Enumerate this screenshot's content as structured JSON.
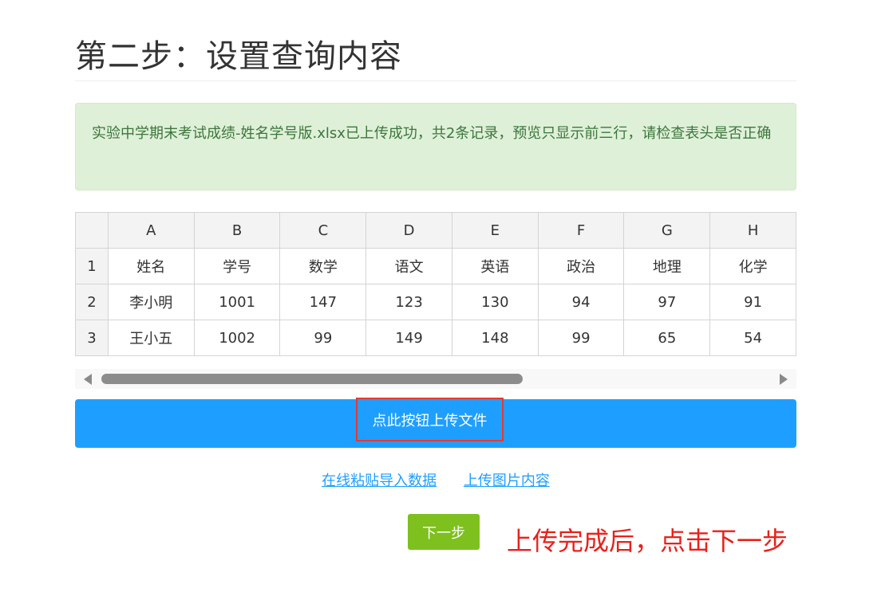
{
  "page": {
    "title": "第二步：设置查询内容"
  },
  "alert": {
    "message": "实验中学期末考试成绩-姓名学号版.xlsx已上传成功，共2条记录，预览只显示前三行，请检查表头是否正确"
  },
  "sheet": {
    "column_letters": [
      "A",
      "B",
      "C",
      "D",
      "E",
      "F",
      "G",
      "H"
    ],
    "rows": [
      {
        "num": "1",
        "cells": [
          "姓名",
          "学号",
          "数学",
          "语文",
          "英语",
          "政治",
          "地理",
          "化学"
        ]
      },
      {
        "num": "2",
        "cells": [
          "李小明",
          "1001",
          "147",
          "123",
          "130",
          "94",
          "97",
          "91"
        ]
      },
      {
        "num": "3",
        "cells": [
          "王小五",
          "1002",
          "99",
          "149",
          "148",
          "99",
          "65",
          "54"
        ]
      }
    ],
    "scroll_fraction": 0.63
  },
  "buttons": {
    "upload_label": "点此按钮上传文件",
    "next_label": "下一步"
  },
  "links": {
    "paste_import": "在线粘贴导入数据",
    "upload_image": "上传图片内容"
  },
  "annotation": {
    "hint": "上传完成后，点击下一步"
  },
  "colors": {
    "accent_blue": "#1e9fff",
    "success_green": "#7ec01e",
    "alert_bg": "#dff0d8",
    "alert_text": "#3c763d",
    "hint_red": "#e8211a"
  }
}
